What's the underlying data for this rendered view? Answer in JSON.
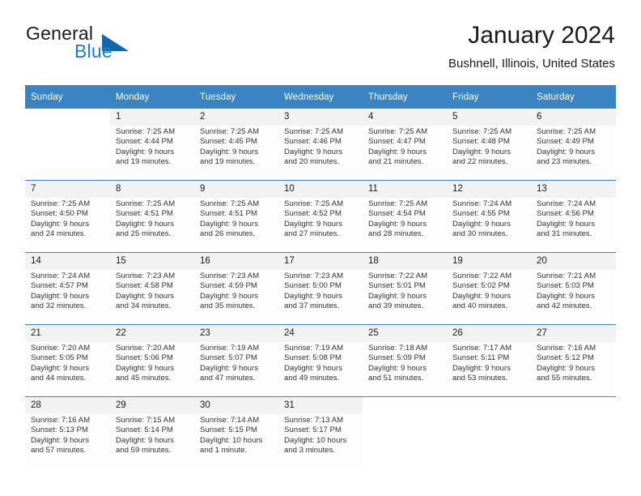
{
  "brand": {
    "word_one": "General",
    "word_two": "Blue",
    "triangle_color": "#1567ad",
    "blue_color": "#1f7cc4"
  },
  "header": {
    "title": "January 2024",
    "location": "Bushnell, Illinois, United States"
  },
  "theme": {
    "header_band": "#3c83c4",
    "daynum_background": "#f2f2f2",
    "cell_background": "#fdfdfd"
  },
  "weekday_headers": [
    "Sunday",
    "Monday",
    "Tuesday",
    "Wednesday",
    "Thursday",
    "Friday",
    "Saturday"
  ],
  "weeks": [
    [
      {
        "day": "",
        "sunrise": "",
        "sunset": "",
        "daylight1": "",
        "daylight2": ""
      },
      {
        "day": "1",
        "sunrise": "Sunrise: 7:25 AM",
        "sunset": "Sunset: 4:44 PM",
        "daylight1": "Daylight: 9 hours",
        "daylight2": "and 19 minutes."
      },
      {
        "day": "2",
        "sunrise": "Sunrise: 7:25 AM",
        "sunset": "Sunset: 4:45 PM",
        "daylight1": "Daylight: 9 hours",
        "daylight2": "and 19 minutes."
      },
      {
        "day": "3",
        "sunrise": "Sunrise: 7:25 AM",
        "sunset": "Sunset: 4:46 PM",
        "daylight1": "Daylight: 9 hours",
        "daylight2": "and 20 minutes."
      },
      {
        "day": "4",
        "sunrise": "Sunrise: 7:25 AM",
        "sunset": "Sunset: 4:47 PM",
        "daylight1": "Daylight: 9 hours",
        "daylight2": "and 21 minutes."
      },
      {
        "day": "5",
        "sunrise": "Sunrise: 7:25 AM",
        "sunset": "Sunset: 4:48 PM",
        "daylight1": "Daylight: 9 hours",
        "daylight2": "and 22 minutes."
      },
      {
        "day": "6",
        "sunrise": "Sunrise: 7:25 AM",
        "sunset": "Sunset: 4:49 PM",
        "daylight1": "Daylight: 9 hours",
        "daylight2": "and 23 minutes."
      }
    ],
    [
      {
        "day": "7",
        "sunrise": "Sunrise: 7:25 AM",
        "sunset": "Sunset: 4:50 PM",
        "daylight1": "Daylight: 9 hours",
        "daylight2": "and 24 minutes."
      },
      {
        "day": "8",
        "sunrise": "Sunrise: 7:25 AM",
        "sunset": "Sunset: 4:51 PM",
        "daylight1": "Daylight: 9 hours",
        "daylight2": "and 25 minutes."
      },
      {
        "day": "9",
        "sunrise": "Sunrise: 7:25 AM",
        "sunset": "Sunset: 4:51 PM",
        "daylight1": "Daylight: 9 hours",
        "daylight2": "and 26 minutes."
      },
      {
        "day": "10",
        "sunrise": "Sunrise: 7:25 AM",
        "sunset": "Sunset: 4:52 PM",
        "daylight1": "Daylight: 9 hours",
        "daylight2": "and 27 minutes."
      },
      {
        "day": "11",
        "sunrise": "Sunrise: 7:25 AM",
        "sunset": "Sunset: 4:54 PM",
        "daylight1": "Daylight: 9 hours",
        "daylight2": "and 28 minutes."
      },
      {
        "day": "12",
        "sunrise": "Sunrise: 7:24 AM",
        "sunset": "Sunset: 4:55 PM",
        "daylight1": "Daylight: 9 hours",
        "daylight2": "and 30 minutes."
      },
      {
        "day": "13",
        "sunrise": "Sunrise: 7:24 AM",
        "sunset": "Sunset: 4:56 PM",
        "daylight1": "Daylight: 9 hours",
        "daylight2": "and 31 minutes."
      }
    ],
    [
      {
        "day": "14",
        "sunrise": "Sunrise: 7:24 AM",
        "sunset": "Sunset: 4:57 PM",
        "daylight1": "Daylight: 9 hours",
        "daylight2": "and 32 minutes."
      },
      {
        "day": "15",
        "sunrise": "Sunrise: 7:23 AM",
        "sunset": "Sunset: 4:58 PM",
        "daylight1": "Daylight: 9 hours",
        "daylight2": "and 34 minutes."
      },
      {
        "day": "16",
        "sunrise": "Sunrise: 7:23 AM",
        "sunset": "Sunset: 4:59 PM",
        "daylight1": "Daylight: 9 hours",
        "daylight2": "and 35 minutes."
      },
      {
        "day": "17",
        "sunrise": "Sunrise: 7:23 AM",
        "sunset": "Sunset: 5:00 PM",
        "daylight1": "Daylight: 9 hours",
        "daylight2": "and 37 minutes."
      },
      {
        "day": "18",
        "sunrise": "Sunrise: 7:22 AM",
        "sunset": "Sunset: 5:01 PM",
        "daylight1": "Daylight: 9 hours",
        "daylight2": "and 39 minutes."
      },
      {
        "day": "19",
        "sunrise": "Sunrise: 7:22 AM",
        "sunset": "Sunset: 5:02 PM",
        "daylight1": "Daylight: 9 hours",
        "daylight2": "and 40 minutes."
      },
      {
        "day": "20",
        "sunrise": "Sunrise: 7:21 AM",
        "sunset": "Sunset: 5:03 PM",
        "daylight1": "Daylight: 9 hours",
        "daylight2": "and 42 minutes."
      }
    ],
    [
      {
        "day": "21",
        "sunrise": "Sunrise: 7:20 AM",
        "sunset": "Sunset: 5:05 PM",
        "daylight1": "Daylight: 9 hours",
        "daylight2": "and 44 minutes."
      },
      {
        "day": "22",
        "sunrise": "Sunrise: 7:20 AM",
        "sunset": "Sunset: 5:06 PM",
        "daylight1": "Daylight: 9 hours",
        "daylight2": "and 45 minutes."
      },
      {
        "day": "23",
        "sunrise": "Sunrise: 7:19 AM",
        "sunset": "Sunset: 5:07 PM",
        "daylight1": "Daylight: 9 hours",
        "daylight2": "and 47 minutes."
      },
      {
        "day": "24",
        "sunrise": "Sunrise: 7:19 AM",
        "sunset": "Sunset: 5:08 PM",
        "daylight1": "Daylight: 9 hours",
        "daylight2": "and 49 minutes."
      },
      {
        "day": "25",
        "sunrise": "Sunrise: 7:18 AM",
        "sunset": "Sunset: 5:09 PM",
        "daylight1": "Daylight: 9 hours",
        "daylight2": "and 51 minutes."
      },
      {
        "day": "26",
        "sunrise": "Sunrise: 7:17 AM",
        "sunset": "Sunset: 5:11 PM",
        "daylight1": "Daylight: 9 hours",
        "daylight2": "and 53 minutes."
      },
      {
        "day": "27",
        "sunrise": "Sunrise: 7:16 AM",
        "sunset": "Sunset: 5:12 PM",
        "daylight1": "Daylight: 9 hours",
        "daylight2": "and 55 minutes."
      }
    ],
    [
      {
        "day": "28",
        "sunrise": "Sunrise: 7:16 AM",
        "sunset": "Sunset: 5:13 PM",
        "daylight1": "Daylight: 9 hours",
        "daylight2": "and 57 minutes."
      },
      {
        "day": "29",
        "sunrise": "Sunrise: 7:15 AM",
        "sunset": "Sunset: 5:14 PM",
        "daylight1": "Daylight: 9 hours",
        "daylight2": "and 59 minutes."
      },
      {
        "day": "30",
        "sunrise": "Sunrise: 7:14 AM",
        "sunset": "Sunset: 5:15 PM",
        "daylight1": "Daylight: 10 hours",
        "daylight2": "and 1 minute."
      },
      {
        "day": "31",
        "sunrise": "Sunrise: 7:13 AM",
        "sunset": "Sunset: 5:17 PM",
        "daylight1": "Daylight: 10 hours",
        "daylight2": "and 3 minutes."
      },
      {
        "day": "",
        "sunrise": "",
        "sunset": "",
        "daylight1": "",
        "daylight2": ""
      },
      {
        "day": "",
        "sunrise": "",
        "sunset": "",
        "daylight1": "",
        "daylight2": ""
      },
      {
        "day": "",
        "sunrise": "",
        "sunset": "",
        "daylight1": "",
        "daylight2": ""
      }
    ]
  ]
}
